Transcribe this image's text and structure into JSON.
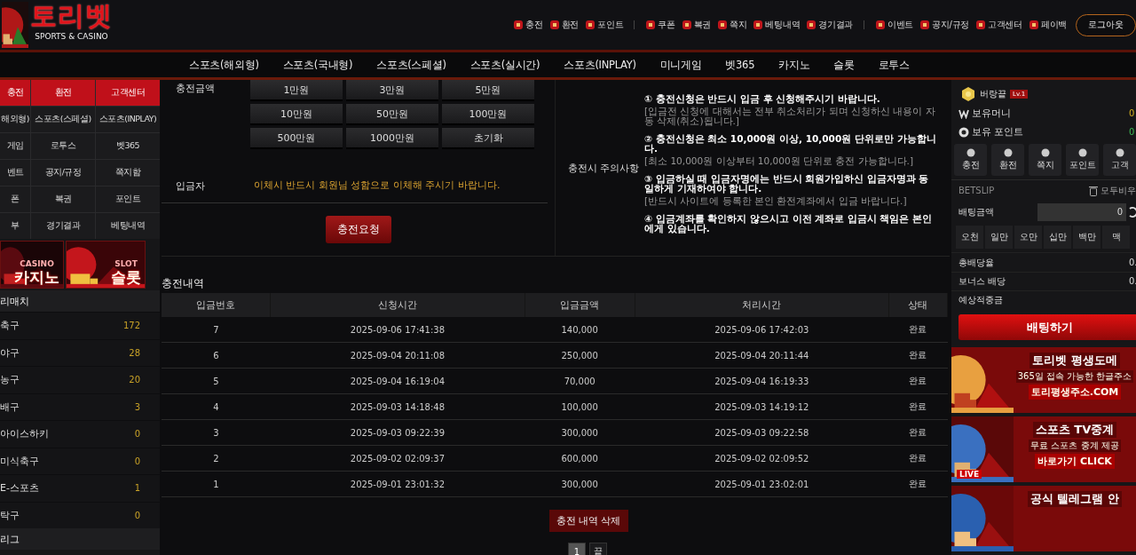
{
  "header": {
    "logo": {
      "title": "토리벳",
      "subtitle": "SPORTS & CASINO"
    },
    "links": [
      {
        "label": "충전",
        "separator_before": false
      },
      {
        "label": "환전",
        "separator_before": false
      },
      {
        "label": "포인트",
        "separator_before": false
      },
      {
        "label": "쿠폰",
        "separator_before": true
      },
      {
        "label": "복권",
        "separator_before": false
      },
      {
        "label": "쪽지",
        "separator_before": false
      },
      {
        "label": "베팅내역",
        "separator_before": false
      },
      {
        "label": "경기결과",
        "separator_before": false
      },
      {
        "label": "이벤트",
        "separator_before": true
      },
      {
        "label": "공지/규정",
        "separator_before": false
      },
      {
        "label": "고객센터",
        "separator_before": false
      },
      {
        "label": "페이백",
        "separator_before": false
      }
    ],
    "logout": "로그아웃"
  },
  "nav": [
    "스포츠(해외형)",
    "스포츠(국내형)",
    "스포츠(스페셜)",
    "스포츠(실시간)",
    "스포츠(INPLAY)",
    "미니게임",
    "벳365",
    "카지노",
    "슬롯",
    "로투스"
  ],
  "sidebar": {
    "quick_menu": [
      {
        "label": "충전",
        "highlighted": true
      },
      {
        "label": "환전",
        "highlighted": true
      },
      {
        "label": "고객센터",
        "highlighted": true
      },
      {
        "label": "해외형)",
        "highlighted": false
      },
      {
        "label": "스포츠(스페셜)",
        "highlighted": false
      },
      {
        "label": "스포츠(INPLAY)",
        "highlighted": false
      },
      {
        "label": "게임",
        "highlighted": false
      },
      {
        "label": "로투스",
        "highlighted": false
      },
      {
        "label": "벳365",
        "highlighted": false
      },
      {
        "label": "벤트",
        "highlighted": false
      },
      {
        "label": "공지/규정",
        "highlighted": false
      },
      {
        "label": "쪽지함",
        "highlighted": false
      },
      {
        "label": "폰",
        "highlighted": false
      },
      {
        "label": "복권",
        "highlighted": false
      },
      {
        "label": "포인트",
        "highlighted": false
      },
      {
        "label": "부",
        "highlighted": false
      },
      {
        "label": "경기결과",
        "highlighted": false
      },
      {
        "label": "베팅내역",
        "highlighted": false
      }
    ],
    "banners": [
      {
        "tag": "CASINO",
        "title": "카지노"
      },
      {
        "tag": "SLOT",
        "title": "슬롯"
      }
    ],
    "sports_header": "리매치",
    "sports": [
      {
        "name": "축구",
        "count": "172"
      },
      {
        "name": "야구",
        "count": "28"
      },
      {
        "name": "농구",
        "count": "20"
      },
      {
        "name": "배구",
        "count": "3"
      },
      {
        "name": "아이스하키",
        "count": "0"
      },
      {
        "name": "미식축구",
        "count": "0"
      },
      {
        "name": "E-스포츠",
        "count": "1"
      },
      {
        "name": "탁구",
        "count": "0"
      }
    ],
    "league_header": "리그"
  },
  "charge_form": {
    "amount_label": "충전금액",
    "amounts": [
      "1만원",
      "3만원",
      "5만원",
      "10만원",
      "50만원",
      "100만원",
      "500만원",
      "1000만원",
      "초기화"
    ],
    "depositor_label": "입금자",
    "depositor_note": "이체시 반드시 회원님 성함으로 이체해 주시기 바랍니다.",
    "submit": "충전요청",
    "notice_label": "충전시 주의사항",
    "notices": [
      {
        "title": "① 충전신청은 반드시 입금 후 신청해주시기 바랍니다.",
        "detail": "[입금전 신청에 대해서는 전부 취소처리가 되며 신청하신 내용이 자동 삭제(취소)됩니다.]"
      },
      {
        "title": "② 충전신청은 최소 10,000원 이상, 10,000원 단위로만 가능합니다.",
        "detail": "[최소 10,000원 이상부터 10,000원 단위로 충전 가능합니다.]"
      },
      {
        "title": "③ 입금하실 때 입금자명에는 반드시 회원가입하신 입금자명과 동일하게 기재하여야 합니다.",
        "detail": "[반드시 사이트에 등록한 본인 환전계좌에서 입금 바랍니다.]"
      },
      {
        "title": "④ 입금계좌를 확인하지 않으시고 이전 계좌로 입금시 책임은 본인에게 있습니다."
      }
    ]
  },
  "history": {
    "title": "충전내역",
    "columns": [
      "입금번호",
      "신청시간",
      "입금금액",
      "처리시간",
      "상태"
    ],
    "rows": [
      [
        "7",
        "2025-09-06 17:41:38",
        "140,000",
        "2025-09-06 17:42:03",
        "완료"
      ],
      [
        "6",
        "2025-09-04 20:11:08",
        "250,000",
        "2025-09-04 20:11:44",
        "완료"
      ],
      [
        "5",
        "2025-09-04 16:19:04",
        "70,000",
        "2025-09-04 16:19:33",
        "완료"
      ],
      [
        "4",
        "2025-09-03 14:18:48",
        "100,000",
        "2025-09-03 14:19:12",
        "완료"
      ],
      [
        "3",
        "2025-09-03 09:22:39",
        "300,000",
        "2025-09-03 09:22:58",
        "완료"
      ],
      [
        "2",
        "2025-09-02 02:09:37",
        "600,000",
        "2025-09-02 02:09:52",
        "완료"
      ],
      [
        "1",
        "2025-09-01 23:01:32",
        "300,000",
        "2025-09-01 23:02:01",
        "완료"
      ]
    ],
    "delete_button": "충전 내역 삭제",
    "pages": [
      {
        "label": "1",
        "selected": true
      },
      {
        "label": "끝",
        "selected": false
      }
    ]
  },
  "right_panel": {
    "user": {
      "name": "버랑끝",
      "level": "Lv.1"
    },
    "balances": [
      {
        "kind": "money",
        "label": "보유머니",
        "value": "0"
      },
      {
        "kind": "point",
        "label": "보유 포인트",
        "value": "0"
      }
    ],
    "quick_buttons": [
      "충전",
      "환전",
      "쪽지",
      "포인트",
      "고객"
    ],
    "betslip": {
      "title": "BETSLIP",
      "clear": "모두비우",
      "amount_label": "배팅금액",
      "amount": "0",
      "chips": [
        "오천",
        "일만",
        "오만",
        "십만",
        "백만",
        "맥"
      ],
      "summary": [
        {
          "label": "총배당율",
          "value": "0."
        },
        {
          "label": "보너스 배당",
          "value": "0."
        },
        {
          "label": "예상적중금"
        }
      ],
      "bet_button": "배팅하기"
    },
    "banners": [
      {
        "title": "토리벳 평생도메",
        "lines": [
          "365일 접속 가능한 한글주소",
          "토리평생주소.COM"
        ]
      },
      {
        "title": "스포츠 TV중계",
        "badge": "LIVE",
        "lines": [
          "무료 스포츠 중계 제공",
          "바로가기 CLICK"
        ]
      },
      {
        "title": "공식 텔레그램 안"
      }
    ]
  }
}
